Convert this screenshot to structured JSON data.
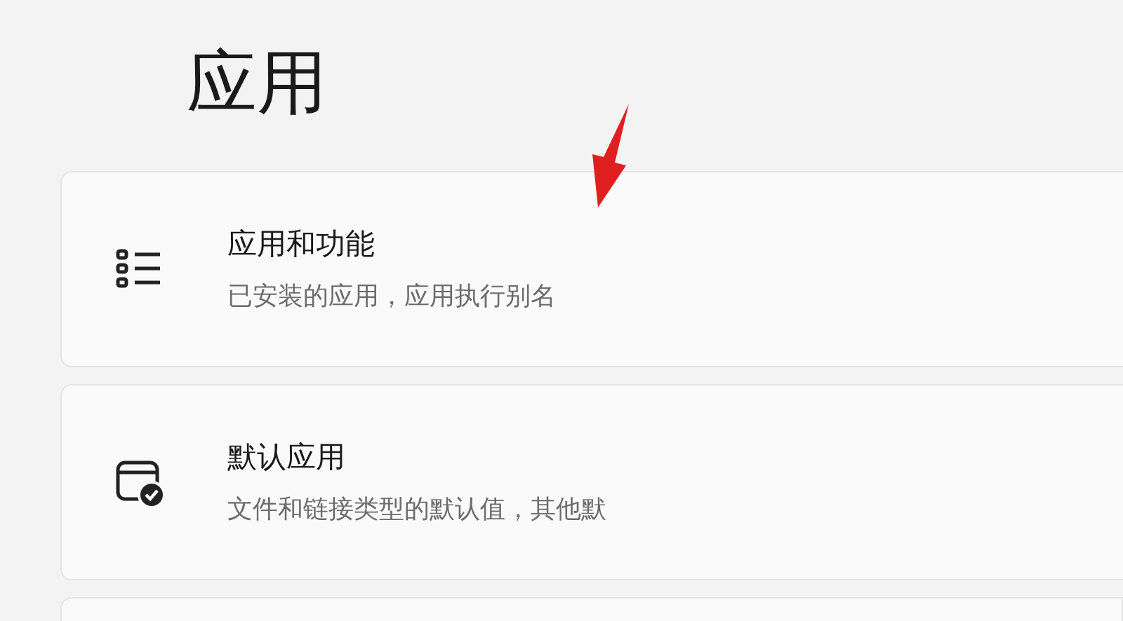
{
  "page_title": "应用",
  "items": [
    {
      "kind": "list",
      "title": "应用和功能",
      "subtitle": "已安装的应用，应用执行别名"
    },
    {
      "kind": "default",
      "title": "默认应用",
      "subtitle": "文件和链接类型的默认值，其他默"
    }
  ]
}
